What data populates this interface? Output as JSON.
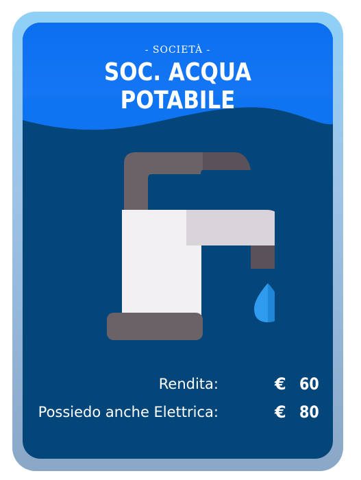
{
  "card": {
    "subtitle": "- SOCIETÀ -",
    "title": "SOC. ACQUA POTABILE",
    "illustration_icon": "faucet-icon",
    "colors": {
      "header": "#0b6ff0",
      "body": "#05467a",
      "frame": "#9ec3e6",
      "drop": "#2e9bee"
    },
    "rows": [
      {
        "label": "Rendita:",
        "currency": "€",
        "amount": "60"
      },
      {
        "label": "Possiedo anche Elettrica:",
        "currency": "€",
        "amount": "80"
      }
    ]
  }
}
